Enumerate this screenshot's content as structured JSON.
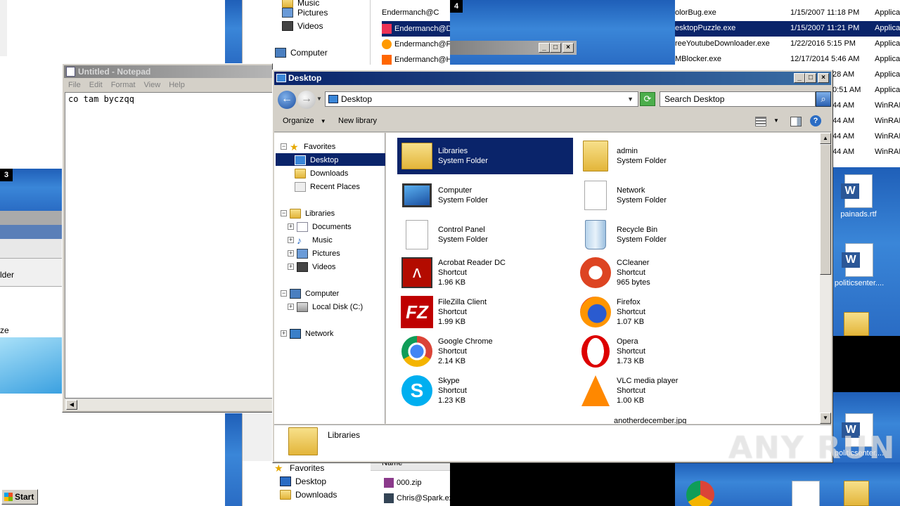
{
  "bg_left_explorer": {
    "nav_items": [
      "Music",
      "Pictures",
      "Videos",
      "Computer"
    ],
    "files": [
      "Endermanch@C",
      "Endermanch@D",
      "Endermanch@F",
      "Endermanch@H"
    ]
  },
  "bg_window_num_4": "4",
  "bg_window_num_3": "3",
  "bg_right_list": {
    "names": [
      "olorBug.exe",
      "esktopPuzzle.exe",
      "reeYoutubeDownloader.exe",
      "MBlocker.exe"
    ],
    "dates": [
      "1/15/2007 11:18 PM",
      "1/15/2007 11:21 PM",
      "1/22/2016 5:15 PM",
      "12/17/2014 5:46 AM"
    ],
    "types": [
      "Applica",
      "Applica",
      "Applica",
      "Applica",
      "Applica",
      "Applica",
      "WinRAI",
      "WinRAI",
      "WinRAI",
      "WinRAI"
    ],
    "times_extra": [
      "28 AM",
      "0:51 AM",
      "44 AM",
      "44 AM",
      "44 AM",
      "44 AM"
    ]
  },
  "bg_left_partial": {
    "lder": "lder",
    "ze": "ze"
  },
  "desktop_icons": [
    "painads.rtf",
    "politicsenter....",
    "politicsenter...."
  ],
  "bottom_explorer": {
    "nav": [
      "Favorites",
      "Desktop",
      "Downloads"
    ],
    "header": "Name",
    "files": [
      "000.zip",
      "Chris@Spark.ex"
    ]
  },
  "taskbar": {
    "start_label": "Start"
  },
  "watermark": "ANY RUN",
  "notepad": {
    "title": "Untitled - Notepad",
    "menu": [
      "File",
      "Edit",
      "Format",
      "View",
      "Help"
    ],
    "content": "co tam byczqq"
  },
  "explorer": {
    "title": "Desktop",
    "address": "Desktop",
    "search_placeholder": "Search Desktop",
    "toolbar": {
      "organize": "Organize",
      "new_library": "New library"
    },
    "nav": {
      "favorites": "Favorites",
      "fav_items": [
        "Desktop",
        "Downloads",
        "Recent Places"
      ],
      "libraries": "Libraries",
      "lib_items": [
        "Documents",
        "Music",
        "Pictures",
        "Videos"
      ],
      "computer": "Computer",
      "comp_items": [
        "Local Disk (C:)"
      ],
      "network": "Network"
    },
    "items": [
      {
        "name": "Libraries",
        "l2": "System Folder",
        "l3": ""
      },
      {
        "name": "admin",
        "l2": "System Folder",
        "l3": ""
      },
      {
        "name": "Computer",
        "l2": "System Folder",
        "l3": ""
      },
      {
        "name": "Network",
        "l2": "System Folder",
        "l3": ""
      },
      {
        "name": "Control Panel",
        "l2": "System Folder",
        "l3": ""
      },
      {
        "name": "Recycle Bin",
        "l2": "System Folder",
        "l3": ""
      },
      {
        "name": "Acrobat Reader DC",
        "l2": "Shortcut",
        "l3": "1.96 KB"
      },
      {
        "name": "CCleaner",
        "l2": "Shortcut",
        "l3": "965 bytes"
      },
      {
        "name": "FileZilla Client",
        "l2": "Shortcut",
        "l3": "1.99 KB"
      },
      {
        "name": "Firefox",
        "l2": "Shortcut",
        "l3": "1.07 KB"
      },
      {
        "name": "Google Chrome",
        "l2": "Shortcut",
        "l3": "2.14 KB"
      },
      {
        "name": "Opera",
        "l2": "Shortcut",
        "l3": "1.73 KB"
      },
      {
        "name": "Skype",
        "l2": "Shortcut",
        "l3": "1.23 KB"
      },
      {
        "name": "VLC media player",
        "l2": "Shortcut",
        "l3": "1.00 KB"
      },
      {
        "name": "anotherdecember.jpg",
        "l2": "",
        "l3": ""
      }
    ],
    "details_title": "Libraries"
  },
  "colors": {
    "selection": "#0a246a",
    "title_active": "#0a246a",
    "desktop_blue": "#2a6cc4"
  }
}
